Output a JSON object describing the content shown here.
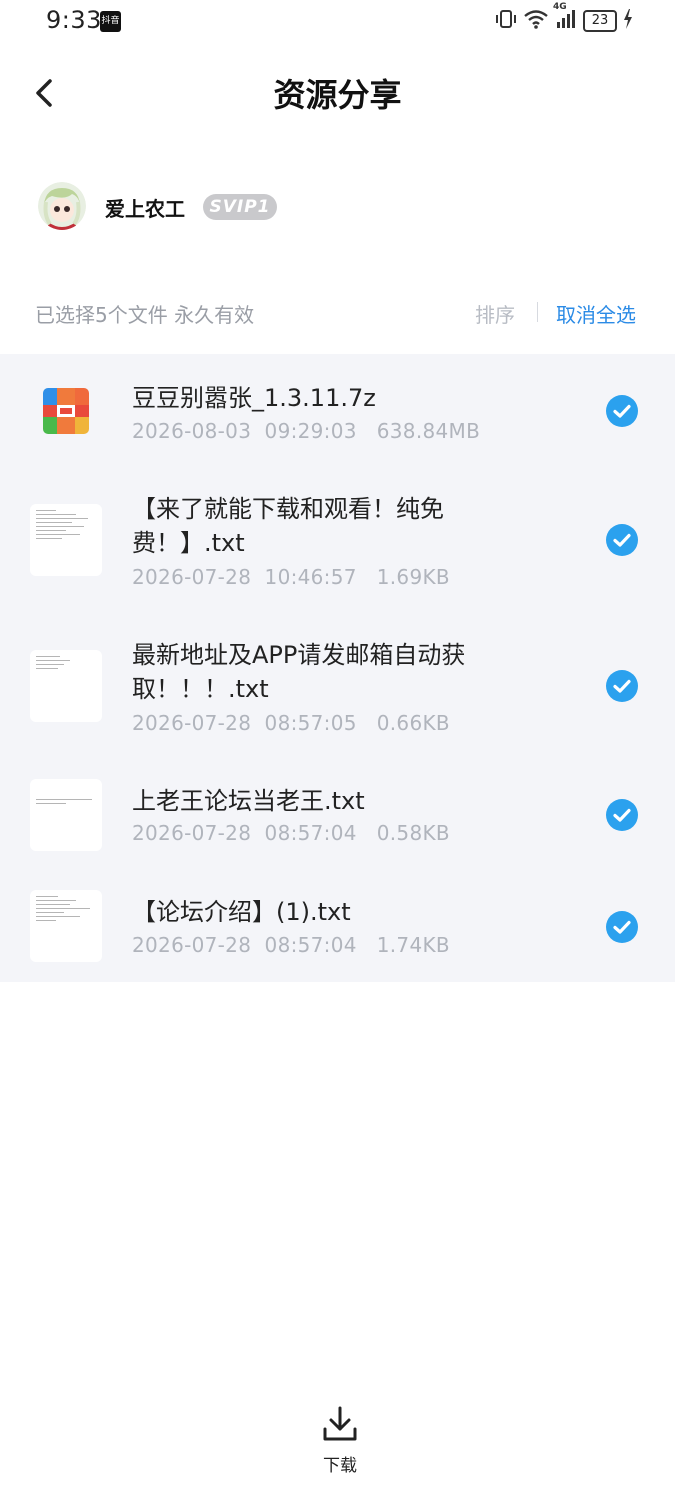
{
  "status_bar": {
    "time": "9:33",
    "app_badge": "抖音",
    "network": "4G",
    "battery": "23"
  },
  "header": {
    "title": "资源分享"
  },
  "user": {
    "name": "爱上农工",
    "badge": "SVIP1"
  },
  "selection": {
    "info": "已选择5个文件 永久有效",
    "sort_label": "排序",
    "cancel_all_label": "取消全选"
  },
  "files": [
    {
      "name": "豆豆别嚣张_1.3.11.7z",
      "meta": "2026-08-03  09:29:03   638.84MB",
      "type": "zip",
      "selected": true
    },
    {
      "name": "【来了就能下载和观看！纯免费！】.txt",
      "meta": "2026-07-28  10:46:57   1.69KB",
      "type": "txt",
      "selected": true
    },
    {
      "name": "最新地址及APP请发邮箱自动获取！！！.txt",
      "meta": "2026-07-28  08:57:05   0.66KB",
      "type": "txt",
      "selected": true
    },
    {
      "name": "上老王论坛当老王.txt",
      "meta": "2026-07-28  08:57:04   0.58KB",
      "type": "txt",
      "selected": true
    },
    {
      "name": "【论坛介绍】(1).txt",
      "meta": "2026-07-28  08:57:04   1.74KB",
      "type": "txt",
      "selected": true
    }
  ],
  "footer": {
    "download_label": "下载"
  },
  "colors": {
    "accent": "#2b8be6",
    "check": "#2ba1ee",
    "list_bg": "#f4f5f9",
    "meta_text": "#b0b4bc"
  }
}
